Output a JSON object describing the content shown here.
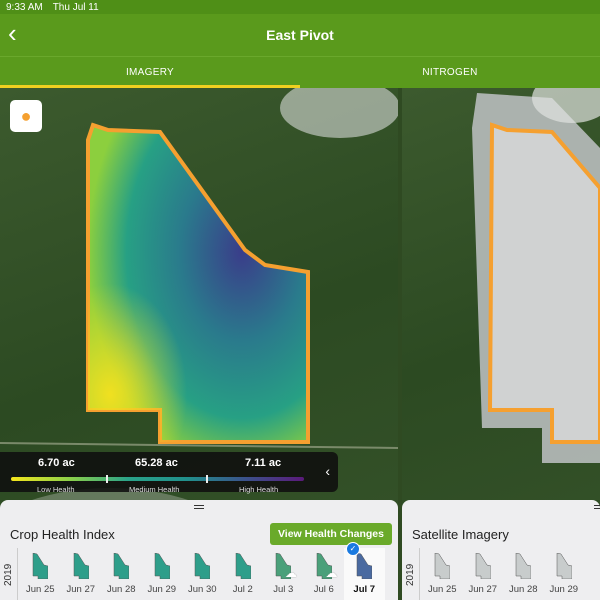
{
  "status_bar": {
    "time": "9:33 AM",
    "date": "Thu Jul 11"
  },
  "header": {
    "title": "East Pivot",
    "back_icon": "chevron-left-icon"
  },
  "tabs": [
    {
      "label": "IMAGERY",
      "active": true
    },
    {
      "label": "NITROGEN",
      "active": false
    }
  ],
  "legend": {
    "low_value": "6.70 ac",
    "medium_value": "65.28 ac",
    "high_value": "7.11 ac",
    "low_label": "Low Health",
    "medium_label": "Medium Health",
    "high_label": "High Health"
  },
  "left_panel": {
    "title": "Crop Health Index",
    "button": "View Health Changes",
    "year": "2019",
    "dates": [
      {
        "label": "Jun 25"
      },
      {
        "label": "Jun 27"
      },
      {
        "label": "Jun 28"
      },
      {
        "label": "Jun 29"
      },
      {
        "label": "Jun 30"
      },
      {
        "label": "Jul 2"
      },
      {
        "label": "Jul 3",
        "cloudy": true
      },
      {
        "label": "Jul 6",
        "cloudy": true
      },
      {
        "label": "Jul 7",
        "selected": true
      }
    ]
  },
  "right_panel": {
    "title": "Satellite Imagery",
    "year": "2019",
    "dates": [
      {
        "label": "Jun 25"
      },
      {
        "label": "Jun 27"
      },
      {
        "label": "Jun 28"
      },
      {
        "label": "Jun 29"
      }
    ]
  },
  "colors": {
    "brand_green": "#5a9a1c",
    "tab_indicator": "#f0d020",
    "field_outline": "#f5a030",
    "button_green": "#6aaa2a"
  }
}
